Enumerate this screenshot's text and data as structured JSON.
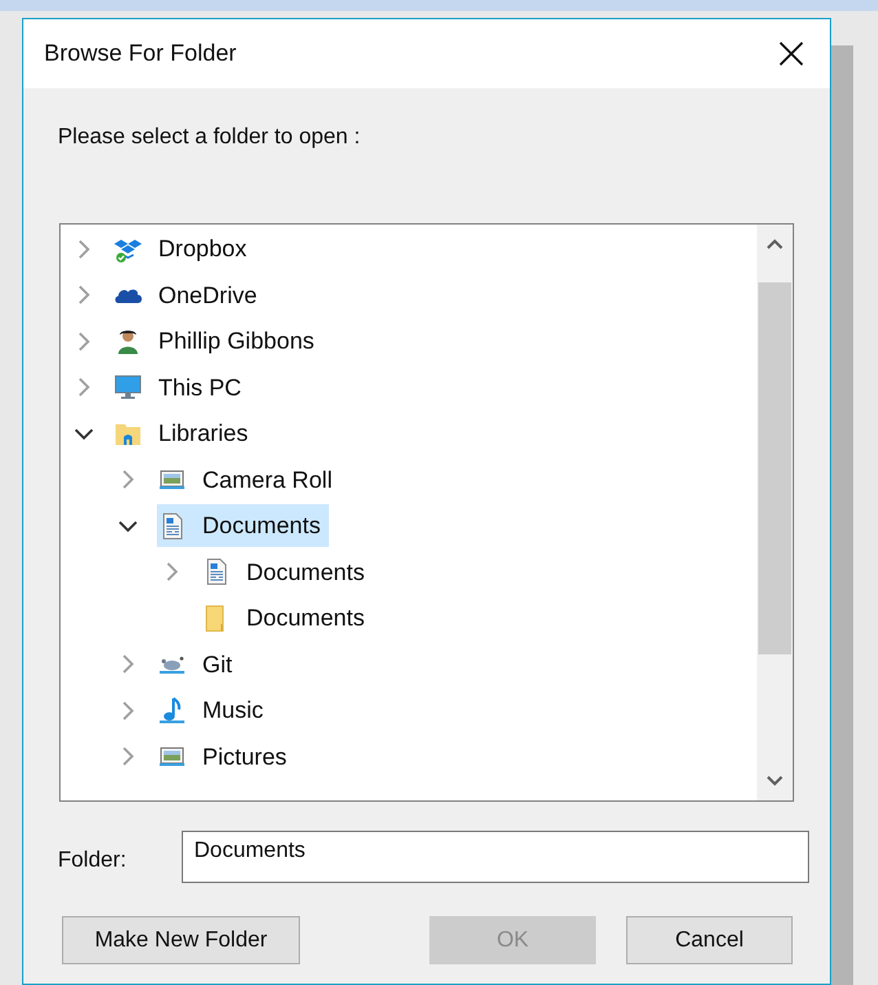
{
  "window": {
    "title": "Browse For Folder"
  },
  "prompt": "Please select a folder to open :",
  "tree": [
    {
      "label": "Dropbox",
      "kind": "dropbox",
      "expanded": false,
      "selected": false
    },
    {
      "label": "OneDrive",
      "kind": "cloud",
      "expanded": false,
      "selected": false
    },
    {
      "label": "Phillip Gibbons",
      "kind": "user",
      "expanded": false,
      "selected": false
    },
    {
      "label": "This PC",
      "kind": "computer",
      "expanded": false,
      "selected": false
    },
    {
      "label": "Libraries",
      "kind": "libraries",
      "expanded": true,
      "selected": false,
      "children": [
        {
          "label": "Camera Roll",
          "kind": "pictures",
          "expanded": false,
          "selected": false
        },
        {
          "label": "Documents",
          "kind": "documents",
          "expanded": true,
          "selected": true,
          "children": [
            {
              "label": "Documents",
              "kind": "documents",
              "expanded": false,
              "selected": false
            },
            {
              "label": "Documents",
              "kind": "folder",
              "selected": false
            }
          ]
        },
        {
          "label": "Git",
          "kind": "git",
          "expanded": false,
          "selected": false
        },
        {
          "label": "Music",
          "kind": "music",
          "expanded": false,
          "selected": false
        },
        {
          "label": "Pictures",
          "kind": "pictures",
          "expanded": false,
          "selected": false
        }
      ]
    }
  ],
  "folder_field": {
    "label": "Folder:",
    "value": "Documents"
  },
  "buttons": [
    {
      "label": "Make New Folder",
      "disabled": false
    },
    {
      "label": "OK",
      "disabled": true
    },
    {
      "label": "Cancel",
      "disabled": false
    }
  ]
}
